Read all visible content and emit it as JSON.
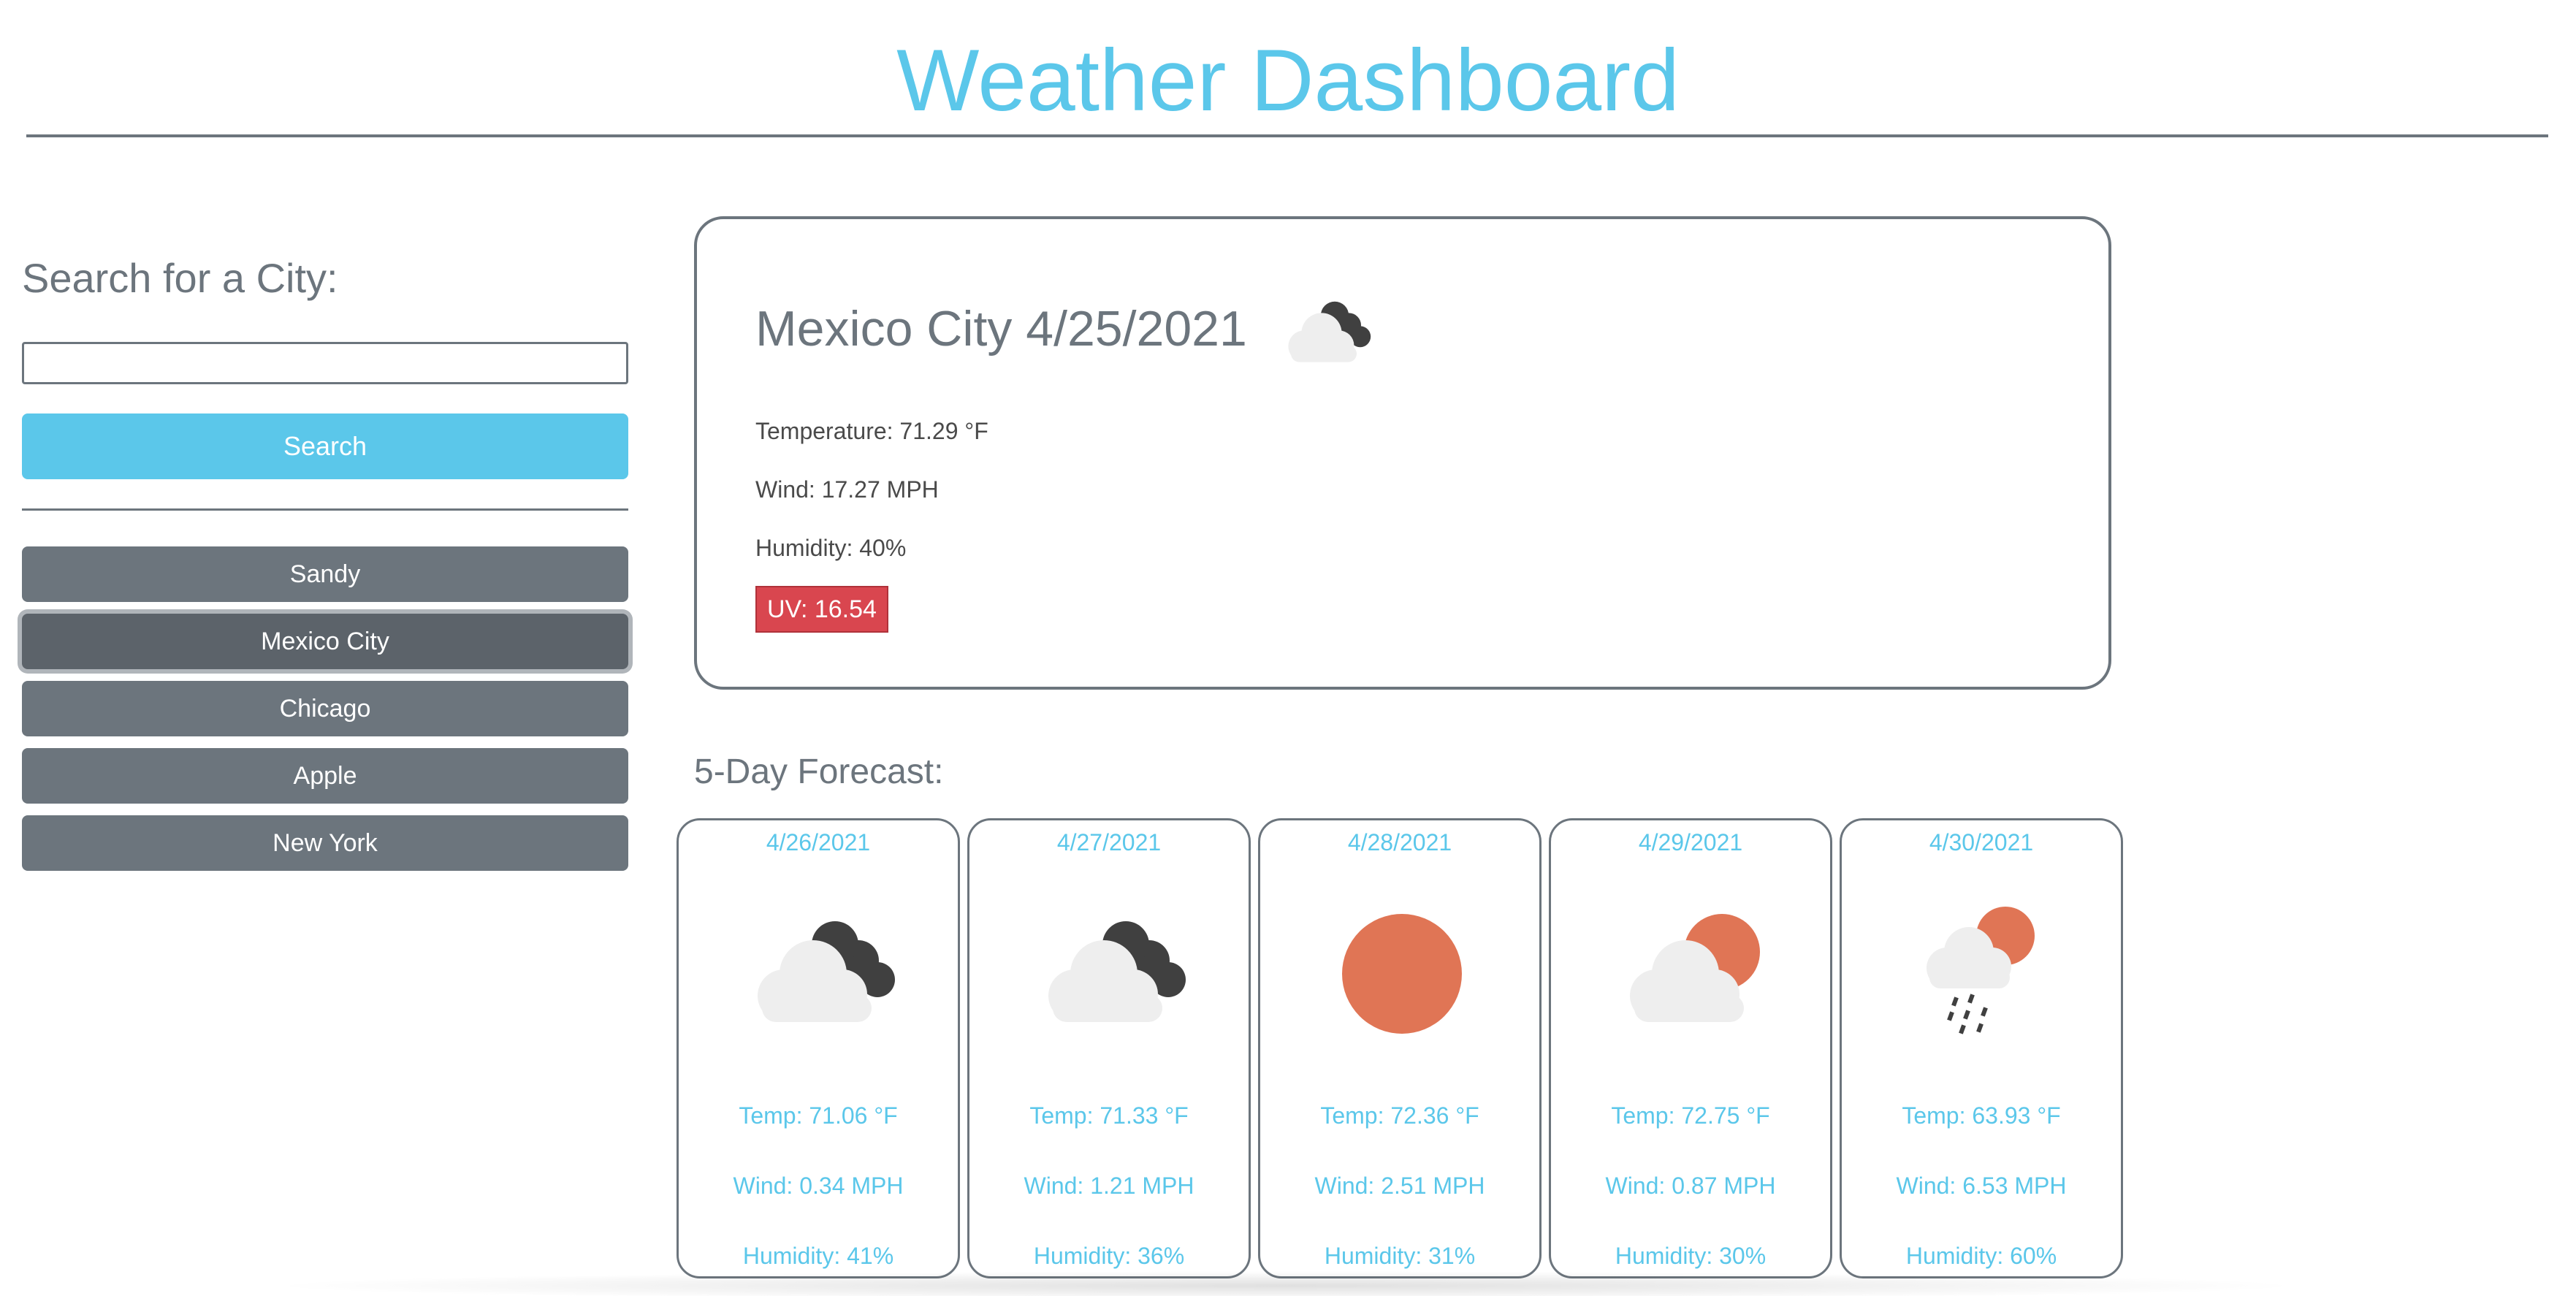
{
  "header": {
    "title": "Weather Dashboard"
  },
  "sidebar": {
    "heading": "Search for a City:",
    "search_value": "",
    "search_label": "Search",
    "history": [
      {
        "label": "Sandy"
      },
      {
        "label": "Mexico City"
      },
      {
        "label": "Chicago"
      },
      {
        "label": "Apple"
      },
      {
        "label": "New York"
      }
    ],
    "active_index": 1
  },
  "current": {
    "title": "Mexico City 4/25/2021",
    "icon": "broken-clouds-icon",
    "temperature": "Temperature: 71.29 °F",
    "wind": "Wind: 17.27 MPH",
    "humidity": "Humidity: 40%",
    "uv": "UV: 16.54",
    "uv_color": "#d9464f"
  },
  "forecast": {
    "heading": "5-Day Forecast:",
    "days": [
      {
        "date": "4/26/2021",
        "icon": "broken-clouds-icon",
        "temp": "Temp: 71.06 °F",
        "wind": "Wind: 0.34 MPH",
        "humidity": "Humidity: 41%"
      },
      {
        "date": "4/27/2021",
        "icon": "broken-clouds-icon",
        "temp": "Temp: 71.33 °F",
        "wind": "Wind: 1.21 MPH",
        "humidity": "Humidity: 36%"
      },
      {
        "date": "4/28/2021",
        "icon": "clear-sky-icon",
        "temp": "Temp: 72.36 °F",
        "wind": "Wind: 2.51 MPH",
        "humidity": "Humidity: 31%"
      },
      {
        "date": "4/29/2021",
        "icon": "few-clouds-icon",
        "temp": "Temp: 72.75 °F",
        "wind": "Wind: 0.87 MPH",
        "humidity": "Humidity: 30%"
      },
      {
        "date": "4/30/2021",
        "icon": "rain-icon",
        "temp": "Temp: 63.93 °F",
        "wind": "Wind: 6.53 MPH",
        "humidity": "Humidity: 60%"
      }
    ]
  },
  "colors": {
    "accent": "#5bc7ea",
    "secondary": "#6c757d",
    "sun": "#e07555",
    "dark_cloud": "#404040",
    "light_cloud": "#eeeeee"
  }
}
